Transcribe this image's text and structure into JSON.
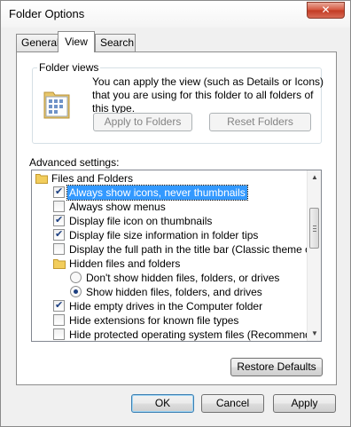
{
  "window": {
    "title": "Folder Options",
    "close_glyph": "✕"
  },
  "tabs": [
    {
      "label": "General",
      "active": false
    },
    {
      "label": "View",
      "active": true
    },
    {
      "label": "Search",
      "active": false
    }
  ],
  "folder_views": {
    "title": "Folder views",
    "description": "You can apply the view (such as Details or Icons) that you are using for this folder to all folders of this type.",
    "apply_label": "Apply to Folders",
    "reset_label": "Reset Folders",
    "icon": "folder-view-icon"
  },
  "advanced": {
    "title": "Advanced settings:",
    "items": [
      {
        "type": "folder",
        "label": "Files and Folders"
      },
      {
        "type": "checkbox",
        "label": "Always show icons, never thumbnails",
        "checked": true,
        "selected": true
      },
      {
        "type": "checkbox",
        "label": "Always show menus",
        "checked": false
      },
      {
        "type": "checkbox",
        "label": "Display file icon on thumbnails",
        "checked": true
      },
      {
        "type": "checkbox",
        "label": "Display file size information in folder tips",
        "checked": true
      },
      {
        "type": "checkbox",
        "label": "Display the full path in the title bar (Classic theme only)",
        "checked": false
      },
      {
        "type": "folder",
        "label": "Hidden files and folders"
      },
      {
        "type": "radio",
        "label": "Don't show hidden files, folders, or drives",
        "checked": false
      },
      {
        "type": "radio",
        "label": "Show hidden files, folders, and drives",
        "checked": true
      },
      {
        "type": "checkbox",
        "label": "Hide empty drives in the Computer folder",
        "checked": true
      },
      {
        "type": "checkbox",
        "label": "Hide extensions for known file types",
        "checked": false
      },
      {
        "type": "checkbox",
        "label": "Hide protected operating system files (Recommended)",
        "checked": false
      }
    ]
  },
  "restore_label": "Restore Defaults",
  "footer": {
    "ok_label": "OK",
    "cancel_label": "Cancel",
    "apply_label": "Apply"
  }
}
